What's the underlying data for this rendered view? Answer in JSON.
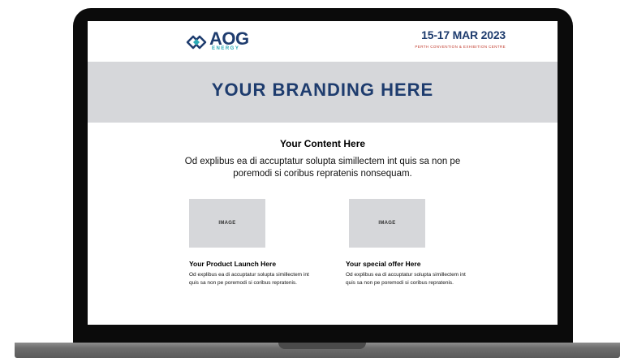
{
  "header": {
    "logo": {
      "name": "AOG",
      "sub": "ENERGY"
    },
    "event": {
      "dates": "15-17 MAR 2023",
      "venue": "PERTH CONVENTION & EXHIBITION CENTRE"
    }
  },
  "branding": {
    "title": "YOUR BRANDING HERE"
  },
  "content": {
    "title": "Your Content Here",
    "body": "Od explibus ea di accuptatur solupta simillectem int quis sa non pe poremodi si coribus repratenis nonsequam."
  },
  "cards": [
    {
      "image_label": "IMAGE",
      "title": "Your Product Launch Here",
      "body": "Od explibus ea di accuptatur solupta simillectem int quis sa non pe poremodi si coribus repratenis."
    },
    {
      "image_label": "IMAGE",
      "title": "Your special offer Here",
      "body": "Od explibus ea di accuptatur solupta simillectem int quis sa non pe poremodi si coribus repratenis."
    }
  ],
  "colors": {
    "brand_navy": "#1e3c6e",
    "accent_teal": "#2aa9b5",
    "band_gray": "#d6d7da",
    "bezel": "#0b0b0b"
  }
}
